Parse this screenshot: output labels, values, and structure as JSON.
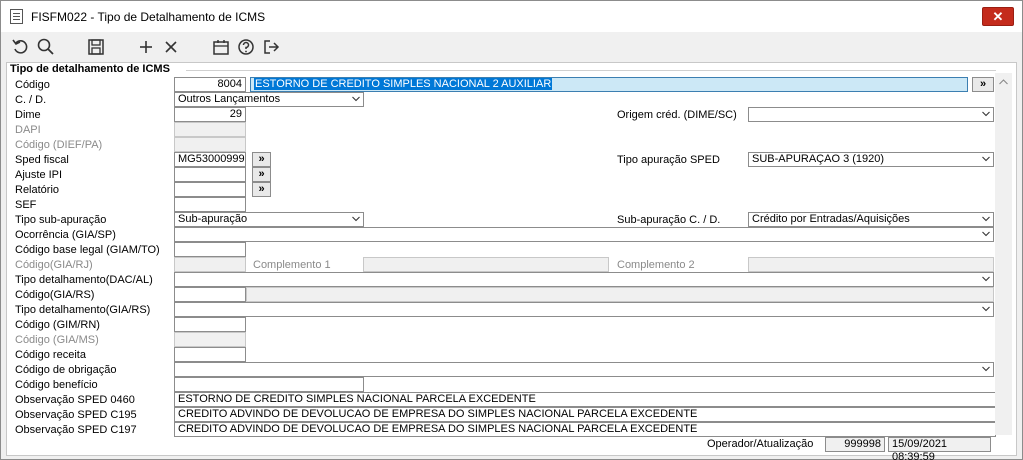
{
  "window": {
    "title": "FISFM022 - Tipo de Detalhamento de ICMS",
    "close_label": "✕"
  },
  "toolbar": {
    "icons": [
      "undo-icon",
      "search-icon",
      "save-icon",
      "add-icon",
      "delete-icon",
      "calendar-icon",
      "help-icon",
      "exit-icon"
    ]
  },
  "group": {
    "title": "Tipo de detalhamento de ICMS"
  },
  "labels": {
    "codigo": "Código",
    "cd": "C. / D.",
    "dime": "Dime",
    "dapi": "DAPI",
    "codigo_dief": "Código (DIEF/PA)",
    "sped_fiscal": "Sped fiscal",
    "ajuste_ipi": "Ajuste IPI",
    "relatorio": "Relatório",
    "sef": "SEF",
    "tipo_sub": "Tipo sub-apuração",
    "ocorrencia": "Ocorrência (GIA/SP)",
    "cod_base_legal": "Código base legal (GIAM/TO)",
    "cod_gia_rj": "Código(GIA/RJ)",
    "complemento1": "Complemento 1",
    "complemento2": "Complemento 2",
    "tipo_dac": "Tipo detalhamento(DAC/AL)",
    "cod_gia_rs": "Código(GIA/RS)",
    "tipo_gia_rs": "Tipo detalhamento(GIA/RS)",
    "cod_gim_rn": "Código (GIM/RN)",
    "cod_gia_ms": "Código (GIA/MS)",
    "cod_receita": "Código receita",
    "cod_obrigacao": "Código de obrigação",
    "cod_beneficio": "Código benefício",
    "obs_0460": "Observação SPED 0460",
    "obs_c195": "Observação SPED C195",
    "obs_c197": "Observação SPED C197",
    "origem_cred": "Origem créd. (DIME/SC)",
    "tipo_apuracao": "Tipo apuração SPED",
    "sub_apuracao_cd": "Sub-apuração C. / D.",
    "operador": "Operador/Atualização"
  },
  "values": {
    "codigo": "8004",
    "descricao": "ESTORNO DE CREDITO SIMPLES NACIONAL 2 AUXILIAR",
    "cd": "Outros Lançamentos",
    "dime": "29",
    "sped_fiscal": "MG53000999",
    "tipo_sub": "Sub-apuração",
    "tipo_apuracao": "SUB-APURAÇAO 3 (1920)",
    "sub_apuracao_cd": "Crédito por Entradas/Aquisições",
    "obs_0460": "ESTORNO DE CREDITO SIMPLES NACIONAL PARCELA EXCEDENTE",
    "obs_c195": "CREDITO ADVINDO DE DEVOLUCAO DE EMPRESA DO SIMPLES NACIONAL PARCELA EXCEDENTE",
    "obs_c197": "CREDITO ADVINDO DE DEVOLUCAO DE EMPRESA DO SIMPLES NACIONAL PARCELA EXCEDENTE",
    "operador": "999998",
    "atualizacao": "15/09/2021 08:39:59"
  },
  "buttons": {
    "lookup": "»"
  }
}
